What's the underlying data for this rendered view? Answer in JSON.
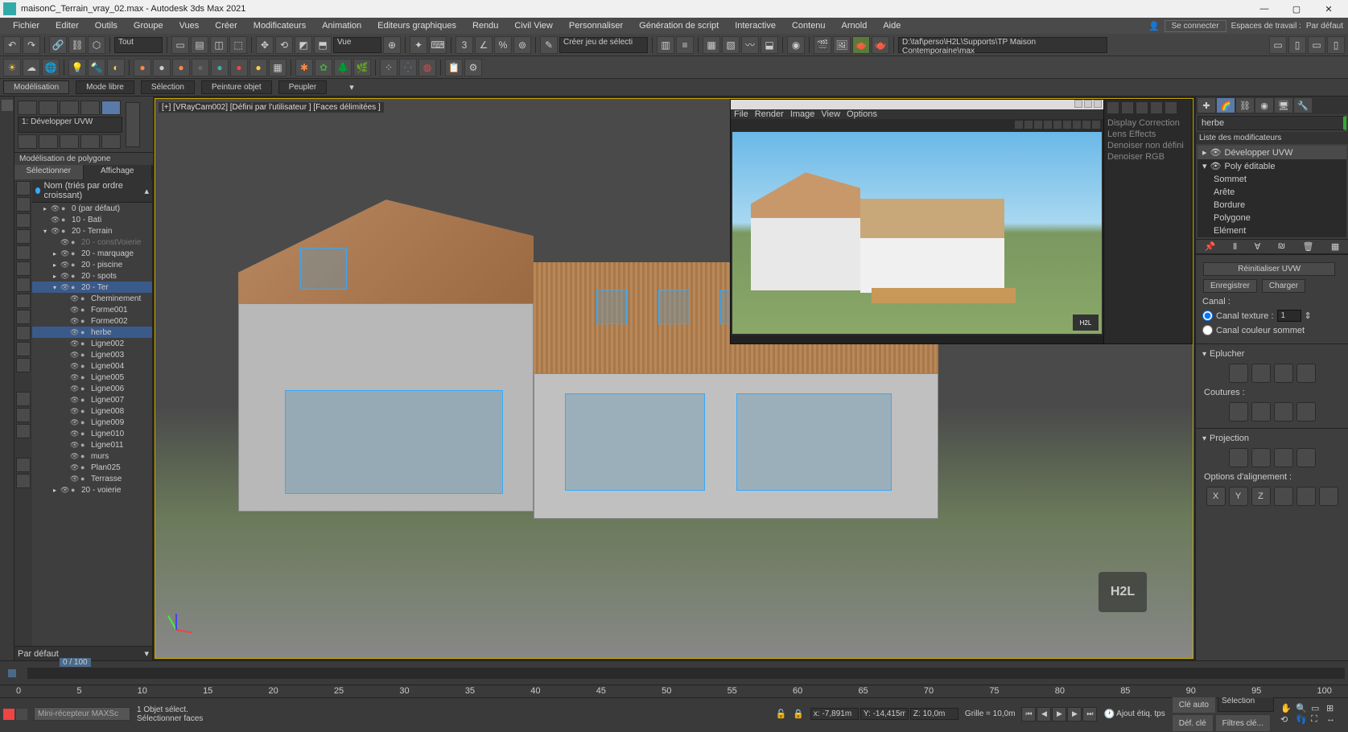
{
  "titlebar": {
    "title": "maisonC_Terrain_vray_02.max - Autodesk 3ds Max 2021"
  },
  "menubar": {
    "items": [
      "Fichier",
      "Editer",
      "Outils",
      "Groupe",
      "Vues",
      "Créer",
      "Modificateurs",
      "Animation",
      "Editeurs graphiques",
      "Rendu",
      "Civil View",
      "Personnaliser",
      "Génération de script",
      "Interactive",
      "Contenu",
      "Arnold",
      "Aide"
    ],
    "connect": "Se connecter",
    "workspaces": "Espaces de travail :",
    "workspace": "Par défaut"
  },
  "toolbar": {
    "selector": "Tout",
    "view": "Vue",
    "create_sel": "Créer jeu de sélecti",
    "path": "D:\\taf\\perso\\H2L\\Supports\\TP Maison Contemporaine\\max"
  },
  "modeling_tabs": [
    "Modélisation",
    "Mode libre",
    "Sélection",
    "Peinture objet",
    "Peupler"
  ],
  "ribbon": {
    "dropdown": "1: Développer UVW",
    "mode": "Modélisation de polygone"
  },
  "scene": {
    "tabs": [
      "Sélectionner",
      "Affichage"
    ],
    "header": "Nom (triés par ordre croissant)",
    "items": [
      {
        "label": "0 (par défaut)",
        "depth": 1,
        "exp": "▸"
      },
      {
        "label": "10 - Bati",
        "depth": 1,
        "exp": ""
      },
      {
        "label": "20 - Terrain",
        "depth": 1,
        "exp": "▾"
      },
      {
        "label": "20 - constVoierie",
        "depth": 2,
        "gray": true,
        "exp": ""
      },
      {
        "label": "20 - marquage",
        "depth": 2,
        "exp": "▸"
      },
      {
        "label": "20 - piscine",
        "depth": 2,
        "exp": "▸"
      },
      {
        "label": "20 - spots",
        "depth": 2,
        "exp": "▸"
      },
      {
        "label": "20 - Ter",
        "depth": 2,
        "exp": "▾",
        "sel": true
      },
      {
        "label": "Cheminement",
        "depth": 3,
        "exp": ""
      },
      {
        "label": "Forme001",
        "depth": 3,
        "exp": ""
      },
      {
        "label": "Forme002",
        "depth": 3,
        "exp": ""
      },
      {
        "label": "herbe",
        "depth": 3,
        "exp": "",
        "sel": true
      },
      {
        "label": "Ligne002",
        "depth": 3,
        "exp": ""
      },
      {
        "label": "Ligne003",
        "depth": 3,
        "exp": ""
      },
      {
        "label": "Ligne004",
        "depth": 3,
        "exp": ""
      },
      {
        "label": "Ligne005",
        "depth": 3,
        "exp": ""
      },
      {
        "label": "Ligne006",
        "depth": 3,
        "exp": ""
      },
      {
        "label": "Ligne007",
        "depth": 3,
        "exp": ""
      },
      {
        "label": "Ligne008",
        "depth": 3,
        "exp": ""
      },
      {
        "label": "Ligne009",
        "depth": 3,
        "exp": ""
      },
      {
        "label": "Ligne010",
        "depth": 3,
        "exp": ""
      },
      {
        "label": "Ligne011",
        "depth": 3,
        "exp": ""
      },
      {
        "label": "murs",
        "depth": 3,
        "exp": ""
      },
      {
        "label": "Plan025",
        "depth": 3,
        "exp": ""
      },
      {
        "label": "Terrasse",
        "depth": 3,
        "exp": ""
      },
      {
        "label": "20 - voierie",
        "depth": 2,
        "exp": "▸"
      }
    ],
    "footer": "Par défaut"
  },
  "viewport": {
    "label": "[+] [VRayCam002] [Défini par l'utilisateur ] [Faces délimitées ]"
  },
  "render": {
    "menus": [
      "File",
      "Render",
      "Image",
      "View",
      "Options"
    ],
    "side": [
      "Display Correction",
      "Lens Effects",
      "Denoiser non défini",
      "Denoiser RGB"
    ],
    "logo": "H2L"
  },
  "right": {
    "search": "herbe",
    "list_header": "Liste des modificateurs",
    "modifiers": [
      {
        "label": "Développer UVW",
        "sel": true,
        "exp": "▸"
      },
      {
        "label": "Poly éditable",
        "exp": "▾"
      },
      {
        "label": "Sommet",
        "sub": true
      },
      {
        "label": "Arête",
        "sub": true
      },
      {
        "label": "Bordure",
        "sub": true
      },
      {
        "label": "Polygone",
        "sub": true
      },
      {
        "label": "Elément",
        "sub": true
      }
    ],
    "uvw": {
      "reset": "Réinitialiser UVW",
      "save": "Enregistrer",
      "load": "Charger",
      "channel": "Canal :",
      "tex_channel": "Canal texture :",
      "tex_value": "1",
      "vertex_color": "Canal couleur sommet"
    },
    "peel": {
      "title": "Eplucher",
      "seams": "Coutures :"
    },
    "proj": {
      "title": "Projection",
      "align": "Options d'alignement :",
      "axes": [
        "X",
        "Y",
        "Z"
      ]
    }
  },
  "timeline": {
    "frame": "0 / 100",
    "ticks": [
      "0",
      "5",
      "10",
      "15",
      "20",
      "25",
      "30",
      "35",
      "40",
      "45",
      "50",
      "55",
      "60",
      "65",
      "70",
      "75",
      "80",
      "85",
      "90",
      "95",
      "100"
    ]
  },
  "status": {
    "script": "Mini-récepteur MAXSc",
    "objects": "1 Objet sélect.",
    "hint": "Sélectionner faces",
    "x": "x: -7,891m",
    "y": "Y: -14,415m",
    "z": "Z: 10,0m",
    "grid": "Grille = 10,0m",
    "add_tag": "Ajout étiq. tps",
    "key_auto": "Clé auto",
    "selection": "Sélection",
    "key_def": "Déf. clé",
    "key_filters": "Filtres clé..."
  },
  "h2l": "H2L"
}
